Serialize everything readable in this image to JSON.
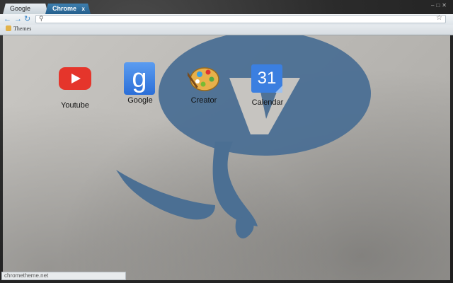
{
  "tabs": [
    {
      "label": "Google",
      "active": false
    },
    {
      "label": "Chrome",
      "active": true,
      "close": "x"
    }
  ],
  "toolbar": {
    "back_icon": "back-arrow-icon",
    "forward_icon": "forward-arrow-icon",
    "reload_icon": "reload-icon",
    "omnibox_value": "",
    "star_icon": "star-icon"
  },
  "bookmarks": [
    {
      "label": "Themes",
      "icon": "theme-folder-icon"
    }
  ],
  "tiles": [
    {
      "label": "Youtube",
      "icon": "youtube-icon"
    },
    {
      "label": "Google",
      "icon": "google-icon",
      "glyph": "g"
    },
    {
      "label": "Creator",
      "icon": "palette-icon"
    },
    {
      "label": "Calendar",
      "icon": "calendar-icon",
      "glyph": "31"
    }
  ],
  "status_text": "chrometheme.net",
  "colors": {
    "active_tab": "#2f6f9f",
    "logo_blue": "#4a6f94",
    "background": "#bdbbb7"
  }
}
